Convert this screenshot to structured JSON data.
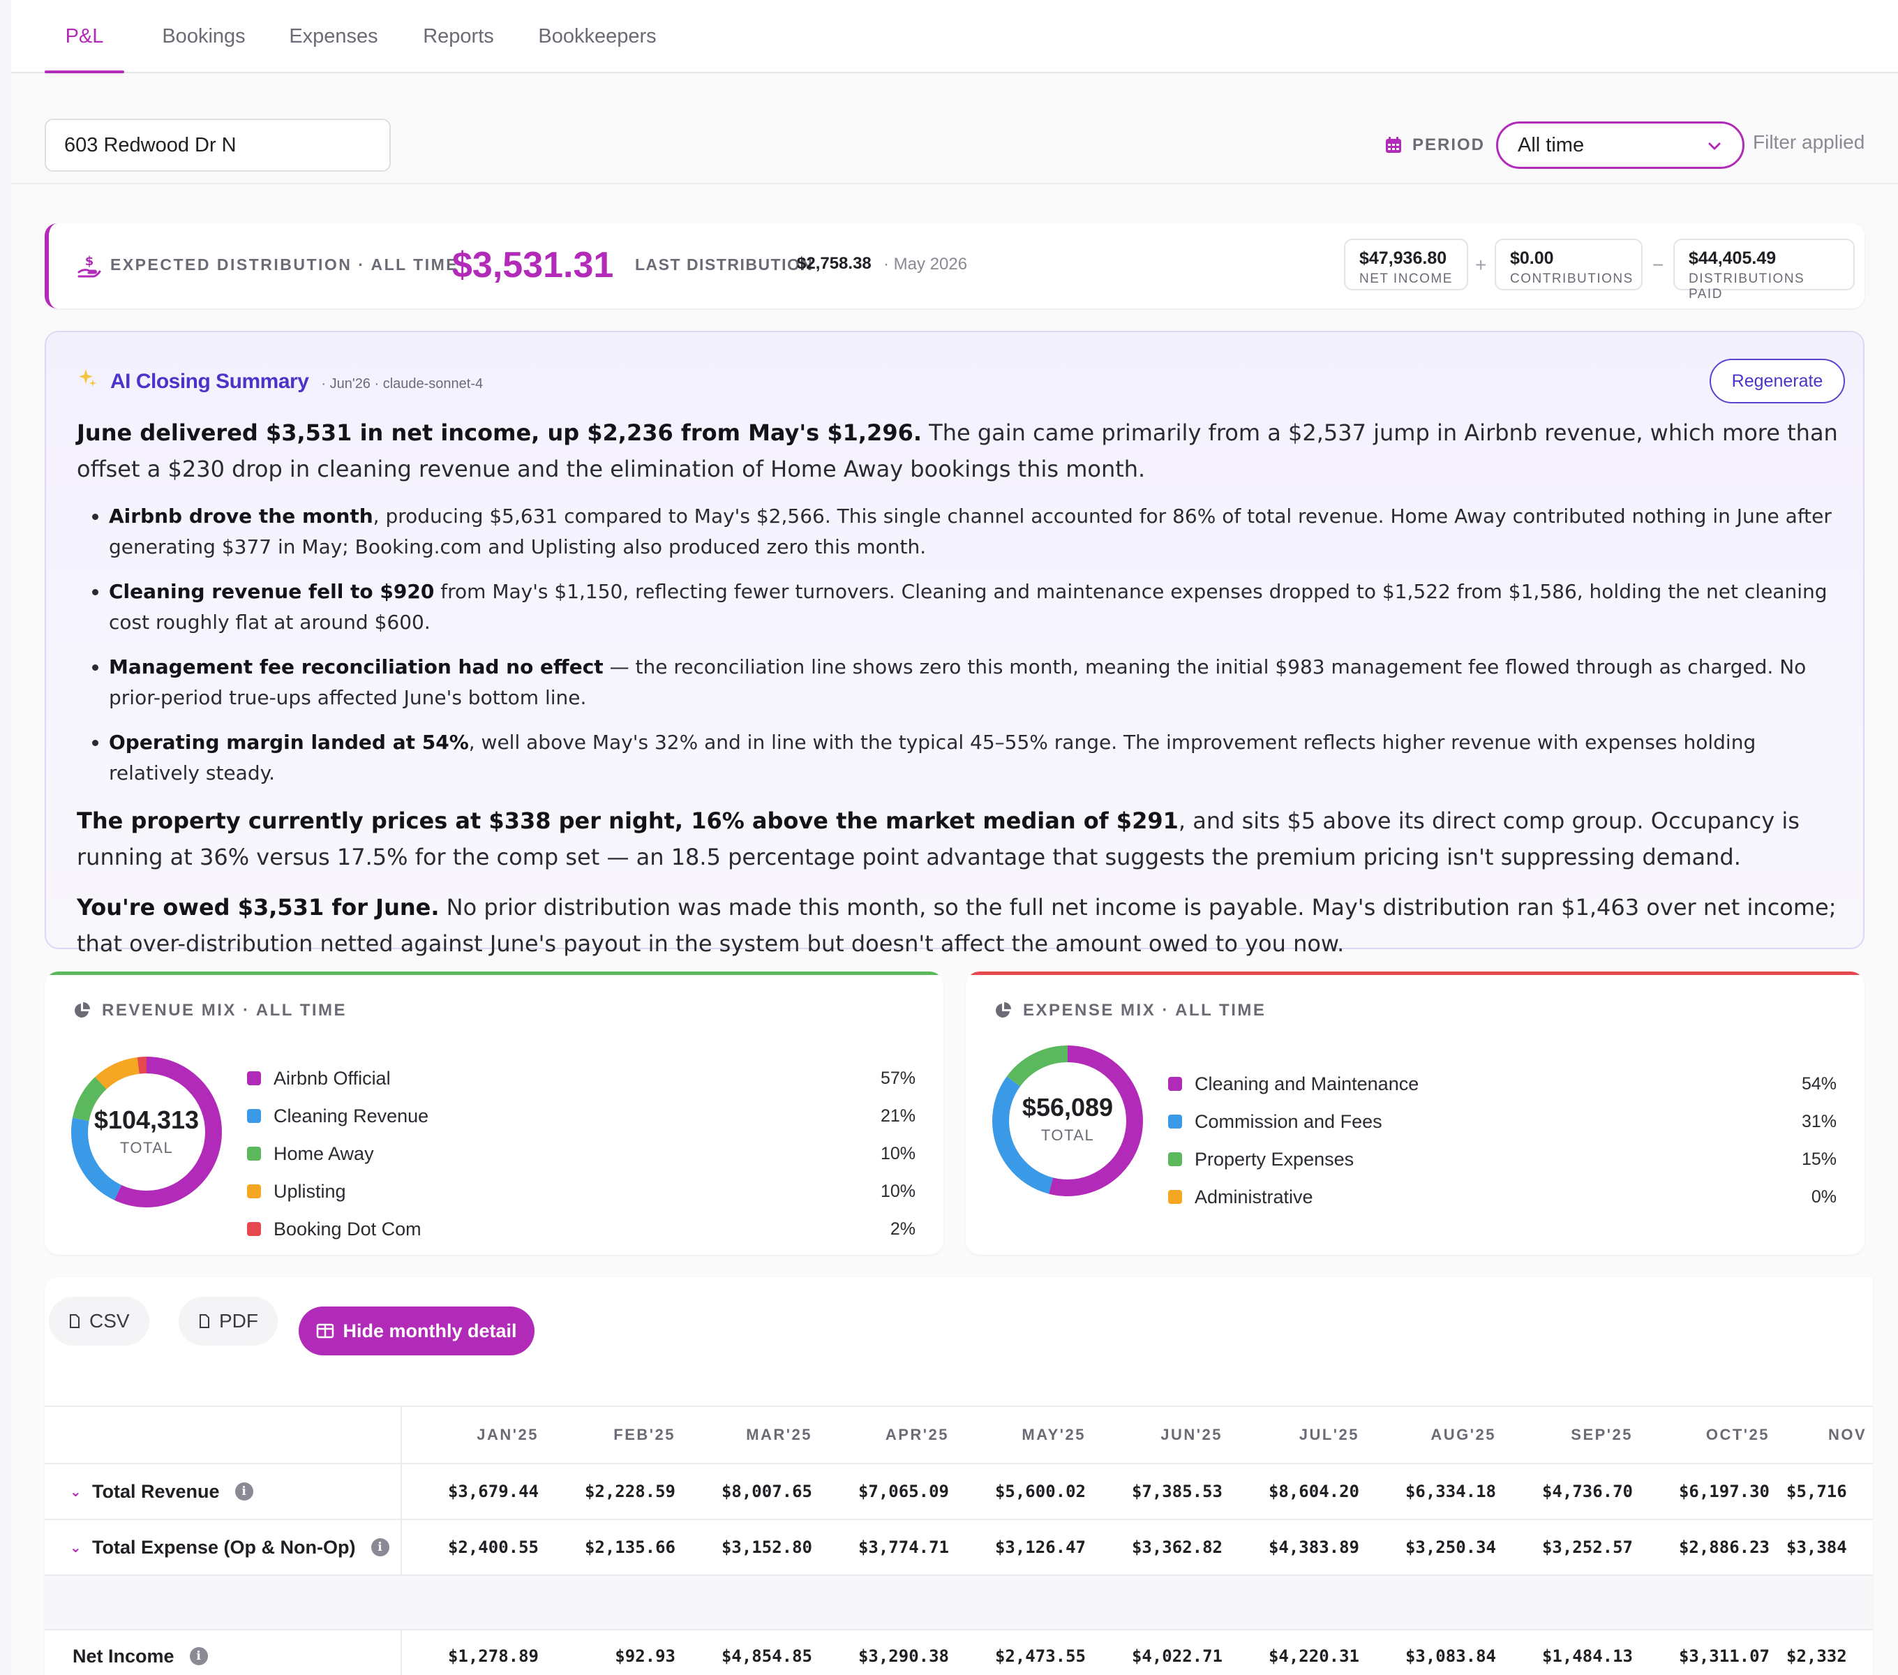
{
  "tabs": [
    {
      "label": "P&L",
      "active": true
    },
    {
      "label": "Bookings",
      "active": false
    },
    {
      "label": "Expenses",
      "active": false
    },
    {
      "label": "Reports",
      "active": false
    },
    {
      "label": "Bookkeepers",
      "active": false
    }
  ],
  "filters": {
    "property": "603 Redwood Dr N",
    "period_label": "PERIOD",
    "period_value": "All time",
    "filter_status": "Filter applied"
  },
  "distribution": {
    "label": "EXPECTED DISTRIBUTION · ALL TIME",
    "amount": "$3,531.31",
    "last_label": "LAST DISTRIBUTION",
    "last_amount": "$2,758.38",
    "last_date": "· May 2026",
    "net_income": {
      "value": "$47,936.80",
      "label": "NET INCOME"
    },
    "plus": "+",
    "contributions": {
      "value": "$0.00",
      "label": "CONTRIBUTIONS"
    },
    "minus": "−",
    "distributions_paid": {
      "value": "$44,405.49",
      "label": "DISTRIBUTIONS PAID"
    }
  },
  "ai_summary": {
    "title": "AI Closing Summary",
    "meta": "· Jun'26 · claude-sonnet-4",
    "regenerate": "Regenerate",
    "p1_bold": "June delivered $3,531 in net income, up $2,236 from May's $1,296.",
    "p1_text": " The gain came primarily from a $2,537 jump in Airbnb revenue, which more than offset a $230 drop in cleaning revenue and the elimination of Home Away bookings this month.",
    "bullets": [
      {
        "bold": "Airbnb drove the month",
        "text": ", producing $5,631 compared to May's $2,566. This single channel accounted for 86% of total revenue. Home Away contributed nothing in June after generating $377 in May; Booking.com and Uplisting also produced zero this month."
      },
      {
        "bold": "Cleaning revenue fell to $920",
        "text": " from May's $1,150, reflecting fewer turnovers. Cleaning and maintenance expenses dropped to $1,522 from $1,586, holding the net cleaning cost roughly flat at around $600."
      },
      {
        "bold": "Management fee reconciliation had no effect",
        "text": " — the reconciliation line shows zero this month, meaning the initial $983 management fee flowed through as charged. No prior-period true-ups affected June's bottom line."
      },
      {
        "bold": "Operating margin landed at 54%",
        "text": ", well above May's 32% and in line with the typical 45–55% range. The improvement reflects higher revenue with expenses holding relatively steady."
      }
    ],
    "p2_bold": "The property currently prices at $338 per night, 16% above the market median of $291",
    "p2_text": ", and sits $5 above its direct comp group. Occupancy is running at 36% versus 17.5% for the comp set — an 18.5 percentage point advantage that suggests the premium pricing isn't suppressing demand.",
    "p3_bold": "You're owed $3,531 for June.",
    "p3_text": " No prior distribution was made this month, so the full net income is payable. May's distribution ran $1,463 over net income; that over-distribution netted against June's payout in the system but doesn't affect the amount owed to you now."
  },
  "revenue_mix": {
    "title": "REVENUE MIX · ALL TIME",
    "total": "$104,313",
    "total_label": "TOTAL",
    "accent": "#5cb85c",
    "items": [
      {
        "name": "Airbnb Official",
        "pct": "57%",
        "value": 57,
        "color": "#b22bb8"
      },
      {
        "name": "Cleaning Revenue",
        "pct": "21%",
        "value": 21,
        "color": "#3b9ae8"
      },
      {
        "name": "Home Away",
        "pct": "10%",
        "value": 10,
        "color": "#5cb85c"
      },
      {
        "name": "Uplisting",
        "pct": "10%",
        "value": 10,
        "color": "#f5a623"
      },
      {
        "name": "Booking Dot Com",
        "pct": "2%",
        "value": 2,
        "color": "#e5484d"
      }
    ]
  },
  "expense_mix": {
    "title": "EXPENSE MIX · ALL TIME",
    "total": "$56,089",
    "total_label": "TOTAL",
    "accent": "#e5484d",
    "items": [
      {
        "name": "Cleaning and Maintenance",
        "pct": "54%",
        "value": 54,
        "color": "#b22bb8"
      },
      {
        "name": "Commission and Fees",
        "pct": "31%",
        "value": 31,
        "color": "#3b9ae8"
      },
      {
        "name": "Property Expenses",
        "pct": "15%",
        "value": 15,
        "color": "#5cb85c"
      },
      {
        "name": "Administrative",
        "pct": "0%",
        "value": 0,
        "color": "#f5a623"
      }
    ]
  },
  "table": {
    "csv": "CSV",
    "pdf": "PDF",
    "toggle": "Hide monthly detail",
    "months": [
      "JAN'25",
      "FEB'25",
      "MAR'25",
      "APR'25",
      "MAY'25",
      "JUN'25",
      "JUL'25",
      "AUG'25",
      "SEP'25",
      "OCT'25",
      "NOV"
    ],
    "rows": [
      {
        "label": "Total Revenue",
        "values": [
          "$3,679.44",
          "$2,228.59",
          "$8,007.65",
          "$7,065.09",
          "$5,600.02",
          "$7,385.53",
          "$8,604.20",
          "$6,334.18",
          "$4,736.70",
          "$6,197.30",
          "$5,716"
        ]
      },
      {
        "label": "Total Expense (Op & Non-Op)",
        "values": [
          "$2,400.55",
          "$2,135.66",
          "$3,152.80",
          "$3,774.71",
          "$3,126.47",
          "$3,362.82",
          "$4,383.89",
          "$3,250.34",
          "$3,252.57",
          "$2,886.23",
          "$3,384"
        ]
      },
      {
        "label": "Net Income",
        "values": [
          "$1,278.89",
          "$92.93",
          "$4,854.85",
          "$3,290.38",
          "$2,473.55",
          "$4,022.71",
          "$4,220.31",
          "$3,083.84",
          "$1,484.13",
          "$3,311.07",
          "$2,332"
        ]
      }
    ]
  }
}
